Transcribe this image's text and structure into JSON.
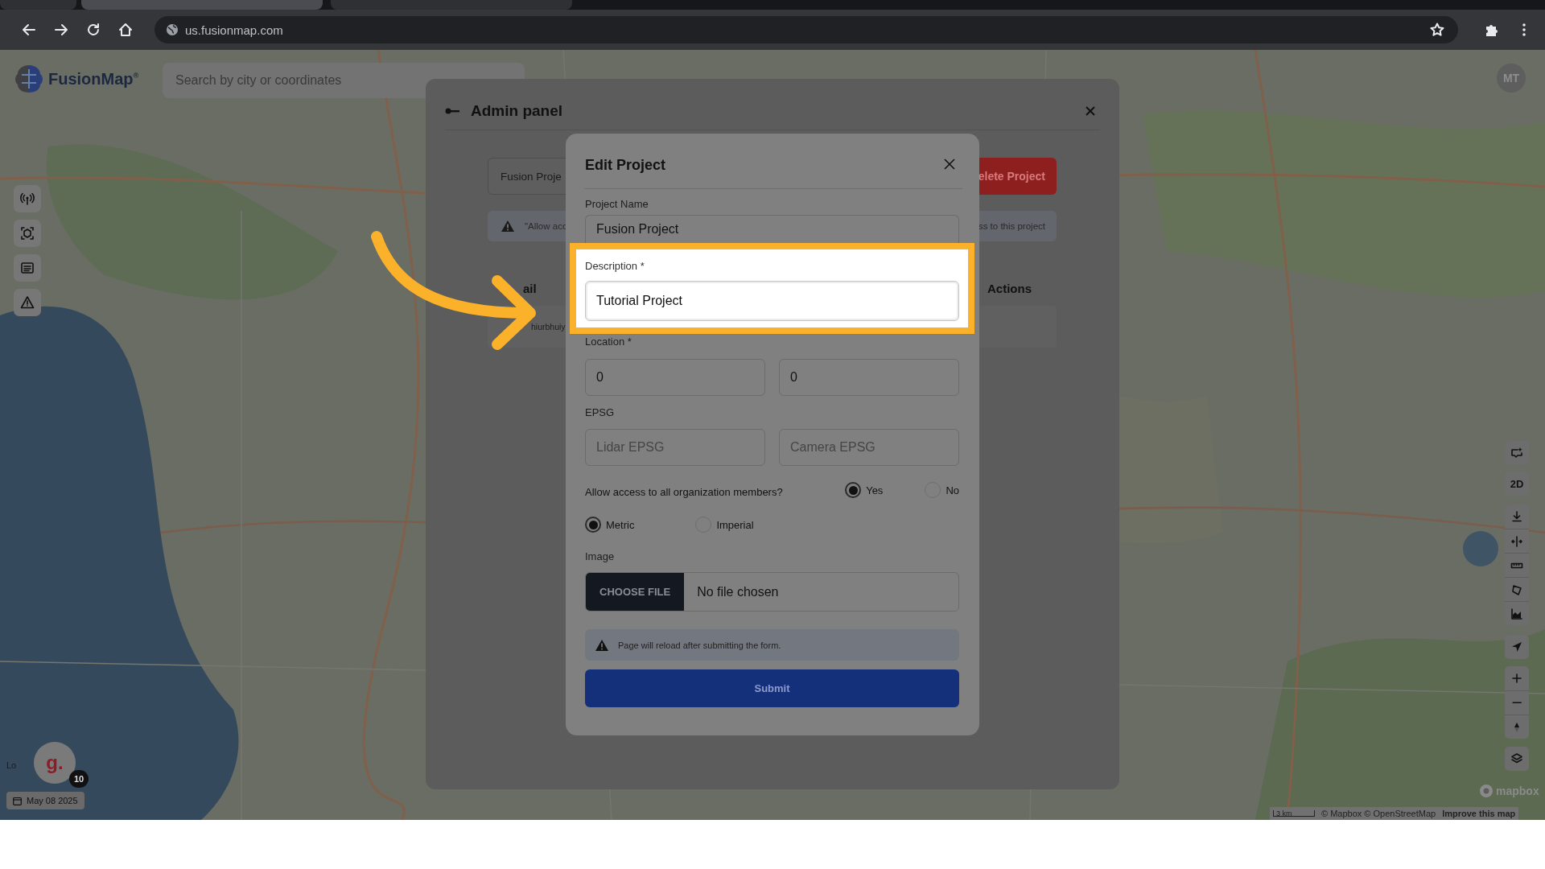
{
  "browser": {
    "tabs": [
      {
        "selected": false
      },
      {
        "selected": true
      },
      {
        "selected": false
      }
    ],
    "address": "us.fusionmap.com"
  },
  "map": {
    "logo": "FusionMap$^{®}$",
    "search": {
      "placeholder": "Search by city or coordinates"
    },
    "user_initials": "MT",
    "mode_label": "2D",
    "avatar_letter": "g.",
    "notification_count": "10",
    "broken_image_alt": "Lo",
    "date": "May 08 2025",
    "attribution": {
      "logo": "mapbox",
      "scale": "3 km",
      "credits": "© Mapbox © OpenStreetMap",
      "improve": "Improve this map"
    }
  },
  "admin_panel": {
    "title": "Admin panel",
    "project_select": "Fusion Proje",
    "delete_button": "elete Project",
    "notice_start": "\"Allow acc",
    "notice_end": "ss to this project",
    "columns": [
      "ail",
      "Actions"
    ],
    "row_email": "hiurbhuiy"
  },
  "edit_project": {
    "title": "Edit Project",
    "project_name": {
      "label": "Project Name",
      "value": "Fusion Project"
    },
    "description": {
      "label": "Description *",
      "value": "Tutorial Project",
      "highlighted": true
    },
    "location": {
      "label": "Location *",
      "values": [
        "0",
        "0"
      ]
    },
    "epsg": {
      "label": "EPSG",
      "placeholders": [
        "Lidar EPSG",
        "Camera EPSG"
      ]
    },
    "access": {
      "question": "Allow access to all organization members?",
      "options": [
        {
          "label": "Yes",
          "selected": true
        },
        {
          "label": "No",
          "selected": false
        }
      ]
    },
    "units": [
      {
        "label": "Metric",
        "selected": true
      },
      {
        "label": "Imperial",
        "selected": false
      }
    ],
    "image": {
      "label": "Image",
      "button": "CHOOSE FILE",
      "status": "No file chosen"
    },
    "notice": "Page will reload after submitting the form.",
    "submit": "Submit"
  }
}
